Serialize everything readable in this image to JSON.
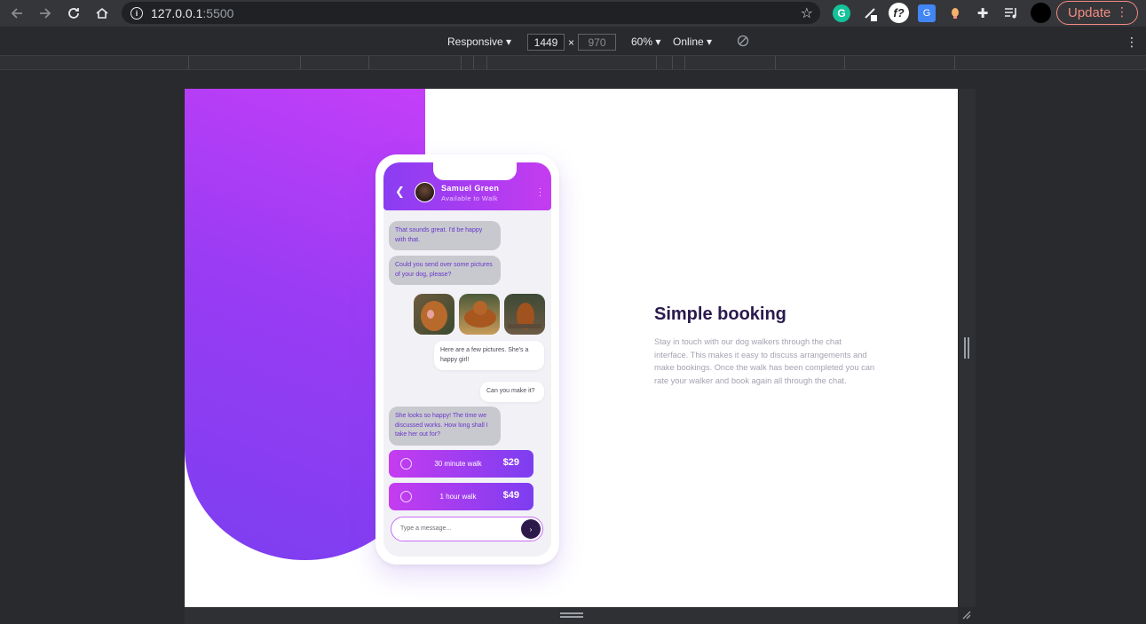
{
  "browser": {
    "url_host": "127.0.0.1",
    "url_port": ":5500",
    "update_label": "Update"
  },
  "devtools": {
    "device": "Responsive",
    "width": "1449",
    "height": "970",
    "zoom": "60%",
    "network": "Online",
    "times_sign": "×"
  },
  "chat": {
    "contact_name": "Samuel Green",
    "contact_status": "Available to Walk",
    "messages": [
      {
        "text": "That sounds great. I'd be happy with that.",
        "from": "walker"
      },
      {
        "text": "Could you send over some pictures of your dog, please?",
        "from": "walker"
      },
      {
        "text": "Here are a few pictures. She's a happy girl!",
        "from": "owner"
      },
      {
        "text": "Can you make it?",
        "from": "owner"
      },
      {
        "text": "She looks so happy! The time we discussed works. How long shall I take her out for?",
        "from": "walker"
      }
    ],
    "options": [
      {
        "label": "30 minute walk",
        "price": "$29"
      },
      {
        "label": "1 hour walk",
        "price": "$49"
      }
    ],
    "composer_placeholder": "Type a message...",
    "send_glyph": "›",
    "back_glyph": "❮"
  },
  "feature": {
    "title": "Simple booking",
    "description": "Stay in touch with our dog walkers through the chat interface. This makes it easy to discuss arrangements and make bookings. Once the walk has been completed you can rate your walker and book again all through the chat."
  },
  "colors": {
    "accent_purple": "#7c3ef0",
    "accent_magenta": "#c53cf0",
    "heading": "#2a1a4d"
  }
}
